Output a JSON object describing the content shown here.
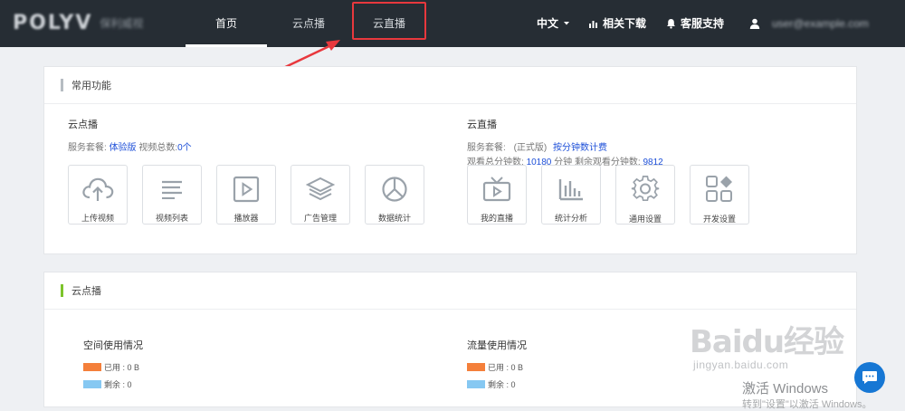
{
  "header": {
    "logo_text": "POLYV",
    "logo_sub": "保利威视",
    "tabs": [
      {
        "label": "首页"
      },
      {
        "label": "云点播"
      },
      {
        "label": "云直播"
      }
    ],
    "language": "中文",
    "downloads": "相关下载",
    "support": "客服支持",
    "user_email": "user@example.com"
  },
  "common": {
    "title": "常用功能",
    "accent": "#b6bcc2",
    "vod": {
      "title": "云点播",
      "plan_label": "服务套餐:",
      "plan_value": "体验版",
      "count_label": "视频总数:",
      "count_value": "0个",
      "tiles": [
        {
          "label": "上传视频",
          "icon": "cloud-upload-icon"
        },
        {
          "label": "视频列表",
          "icon": "list-icon"
        },
        {
          "label": "播放器",
          "icon": "play-icon"
        },
        {
          "label": "广告管理",
          "icon": "layers-icon"
        },
        {
          "label": "数据统计",
          "icon": "pie-chart-icon"
        }
      ]
    },
    "live": {
      "title": "云直播",
      "plan_label": "服务套餐:",
      "plan_edition": "(正式版)",
      "plan_value": "按分钟数计费",
      "minutes_label": "观看总分钟数:",
      "minutes_value": "10180",
      "minutes_unit": "分钟",
      "remain_label": "剩余观看分钟数:",
      "remain_value": "9812",
      "tiles": [
        {
          "label": "我的直播",
          "icon": "tv-icon"
        },
        {
          "label": "统计分析",
          "icon": "bar-chart-icon"
        },
        {
          "label": "通用设置",
          "icon": "gear-icon"
        },
        {
          "label": "开发设置",
          "icon": "grid-icon"
        }
      ]
    }
  },
  "vod_card": {
    "title": "云点播",
    "accent": "#7dc42b",
    "space": {
      "title": "空间使用情况",
      "used": "已用 : 0 B",
      "remain": "剩余 : 0"
    },
    "traffic": {
      "title": "流量使用情况",
      "used": "已用 : 0 B",
      "remain": "剩余 : 0"
    },
    "used_color": "#f47f3a",
    "remain_color": "#86c8f2"
  },
  "watermark": {
    "brand": "Baidu经验",
    "url": "jingyan.baidu.com",
    "activate": "激活 Windows",
    "activate_sub": "转到\"设置\"以激活 Windows。"
  }
}
